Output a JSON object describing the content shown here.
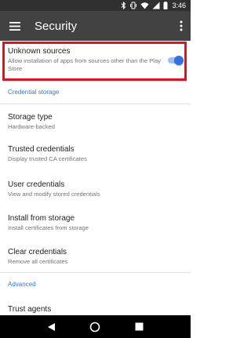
{
  "status_bar": {
    "time": "3:46",
    "icons": [
      "bluetooth-icon",
      "vibrate-icon",
      "wifi-icon",
      "signal-icon",
      "battery-icon"
    ]
  },
  "app_bar": {
    "title": "Security",
    "menu_icon": "hamburger-menu-icon",
    "more_icon": "more-vert-icon"
  },
  "settings": {
    "unknown_sources": {
      "label": "Unknown sources",
      "summary": "Allow installation of apps from sources other than the Play Store",
      "enabled": true
    },
    "credential_storage_header": "Credential storage",
    "storage_type": {
      "label": "Storage type",
      "summary": "Hardware-backed"
    },
    "trusted_credentials": {
      "label": "Trusted credentials",
      "summary": "Display trusted CA certificates"
    },
    "user_credentials": {
      "label": "User credentials",
      "summary": "View and modify stored credentials"
    },
    "install_from_storage": {
      "label": "Install from storage",
      "summary": "Install certificates from storage"
    },
    "clear_credentials": {
      "label": "Clear credentials",
      "summary": "Remove all certificates"
    },
    "advanced_header": "Advanced",
    "trust_agents": {
      "label": "Trust agents"
    }
  },
  "colors": {
    "accent": "#2f7ae5",
    "highlight": "#e8101f",
    "app_bar": "#424242",
    "status_bar": "#303030"
  }
}
